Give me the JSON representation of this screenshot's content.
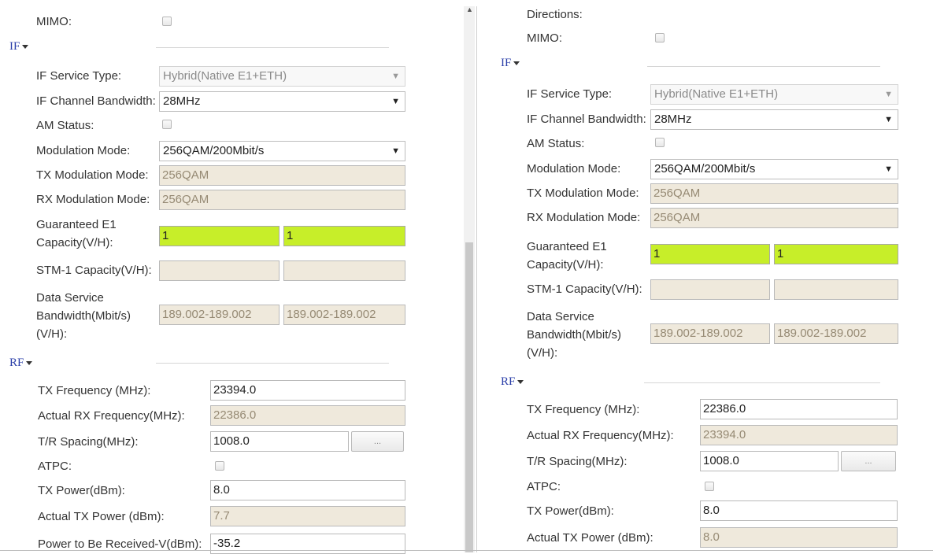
{
  "left": {
    "mimo_label": "MIMO:",
    "if_header": "IF",
    "if_service_type_label": "IF Service Type:",
    "if_service_type_value": "Hybrid(Native E1+ETH)",
    "if_channel_bw_label": "IF Channel Bandwidth:",
    "if_channel_bw_value": "28MHz",
    "am_status_label": "AM Status:",
    "modulation_mode_label": "Modulation Mode:",
    "modulation_mode_value": "256QAM/200Mbit/s",
    "tx_mod_label": "TX Modulation Mode:",
    "tx_mod_value": "256QAM",
    "rx_mod_label": "RX Modulation Mode:",
    "rx_mod_value": "256QAM",
    "guaranteed_e1_label_1": "Guaranteed E1",
    "guaranteed_e1_label_2": "Capacity(V/H):",
    "guaranteed_e1_v": "1",
    "guaranteed_e1_h": "1",
    "stm1_label": "STM-1 Capacity(V/H):",
    "stm1_v": "",
    "stm1_h": "",
    "data_bw_label_1": "Data Service",
    "data_bw_label_2": "Bandwidth(Mbit/s)",
    "data_bw_label_3": "(V/H):",
    "data_bw_v": "189.002-189.002",
    "data_bw_h": "189.002-189.002",
    "rf_header": "RF",
    "tx_freq_label": "TX Frequency (MHz):",
    "tx_freq_value": "23394.0",
    "actual_rx_freq_label": "Actual RX Frequency(MHz):",
    "actual_rx_freq_value": "22386.0",
    "tr_spacing_label": "T/R Spacing(MHz):",
    "tr_spacing_value": "1008.0",
    "tr_spacing_button": "...",
    "atpc_label": "ATPC:",
    "tx_power_label": "TX Power(dBm):",
    "tx_power_value": "8.0",
    "actual_tx_power_label": "Actual TX Power (dBm):",
    "actual_tx_power_value": "7.7",
    "power_rx_label": "Power to Be Received-V(dBm):",
    "power_rx_value": "-35.2"
  },
  "right": {
    "directions_label": "Directions:",
    "mimo_label": "MIMO:",
    "if_header": "IF",
    "if_service_type_label": "IF Service Type:",
    "if_service_type_value": "Hybrid(Native E1+ETH)",
    "if_channel_bw_label": "IF Channel Bandwidth:",
    "if_channel_bw_value": "28MHz",
    "am_status_label": "AM Status:",
    "modulation_mode_label": "Modulation Mode:",
    "modulation_mode_value": "256QAM/200Mbit/s",
    "tx_mod_label": "TX Modulation Mode:",
    "tx_mod_value": "256QAM",
    "rx_mod_label": "RX Modulation Mode:",
    "rx_mod_value": "256QAM",
    "guaranteed_e1_label_1": "Guaranteed E1",
    "guaranteed_e1_label_2": "Capacity(V/H):",
    "guaranteed_e1_v": "1",
    "guaranteed_e1_h": "1",
    "stm1_label": "STM-1 Capacity(V/H):",
    "stm1_v": "",
    "stm1_h": "",
    "data_bw_label_1": "Data Service",
    "data_bw_label_2": "Bandwidth(Mbit/s)",
    "data_bw_label_3": "(V/H):",
    "data_bw_v": "189.002-189.002",
    "data_bw_h": "189.002-189.002",
    "rf_header": "RF",
    "tx_freq_label": "TX Frequency (MHz):",
    "tx_freq_value": "22386.0",
    "actual_rx_freq_label": "Actual RX Frequency(MHz):",
    "actual_rx_freq_value": "23394.0",
    "tr_spacing_label": "T/R Spacing(MHz):",
    "tr_spacing_value": "1008.0",
    "tr_spacing_button": "...",
    "atpc_label": "ATPC:",
    "tx_power_label": "TX Power(dBm):",
    "tx_power_value": "8.0",
    "actual_tx_power_label": "Actual TX Power (dBm):",
    "actual_tx_power_value": "8.0"
  },
  "icons": {
    "section_toggle": "chevron-down-icon",
    "select_arrow": "dropdown-arrow-icon",
    "scroll_up": "scroll-up-arrow-icon"
  },
  "colors": {
    "highlight_field": "#c7ee29",
    "readonly_field": "#efe9dc",
    "section_header": "#2a3ea8"
  }
}
